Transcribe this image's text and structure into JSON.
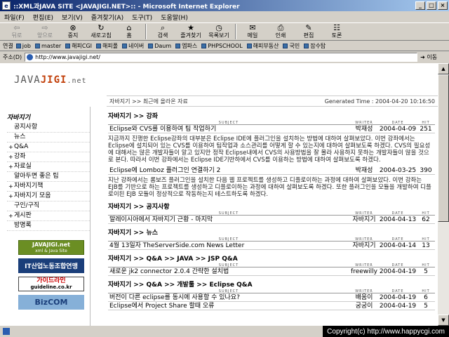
{
  "window": {
    "title": "::XML과JAVA SITE <JAVAJIGI.NET>:: - Microsoft Internet Explorer"
  },
  "menu": [
    "파일(F)",
    "편집(E)",
    "보기(V)",
    "즐겨찾기(A)",
    "도구(T)",
    "도움말(H)"
  ],
  "toolbar": [
    {
      "label": "뒤로",
      "icon": "back-arrow-icon",
      "disabled": true
    },
    {
      "label": "앞으로",
      "icon": "forward-arrow-icon",
      "disabled": true
    },
    {
      "label": "중지",
      "icon": "stop-icon"
    },
    {
      "label": "새로고침",
      "icon": "refresh-icon"
    },
    {
      "label": "홈",
      "icon": "home-icon"
    },
    {
      "label": "검색",
      "icon": "search-icon"
    },
    {
      "label": "즐겨찾기",
      "icon": "favorites-icon"
    },
    {
      "label": "목록보기",
      "icon": "history-icon"
    },
    {
      "label": "메일",
      "icon": "mail-icon"
    },
    {
      "label": "인쇄",
      "icon": "print-icon"
    },
    {
      "label": "편집",
      "icon": "edit-icon"
    },
    {
      "label": "토론",
      "icon": "discuss-icon"
    }
  ],
  "links": {
    "label": "연결",
    "items": [
      "job",
      "master",
      "해피CGI",
      "해피폴",
      "네이버",
      "Daum",
      "엠파스",
      "PHPSCHOOL",
      "해피부동산",
      "국민",
      "잡수탑"
    ]
  },
  "address": {
    "label": "주소(D)",
    "value": "http://www.javajigi.net/",
    "go": "이동"
  },
  "page": {
    "logo": {
      "prefix": "JAVA",
      "brand": "JIGI",
      "suffix": ".net"
    },
    "breadcrumb": "자바지기 >> 최근에 올라온 자료",
    "generated": "Generated Time : 2004-04-20 10:16:50",
    "sidebar": {
      "heading": "자바지기",
      "items": [
        {
          "label": "공지사항",
          "plus": false
        },
        {
          "label": "뉴스",
          "plus": false
        },
        {
          "label": "Q&A",
          "plus": true
        },
        {
          "label": "강좌",
          "plus": true
        },
        {
          "label": "자료실",
          "plus": true
        },
        {
          "label": "알아두면 좋은 팁",
          "plus": false
        },
        {
          "label": "자바지기책",
          "plus": true
        },
        {
          "label": "자바지기 모음",
          "plus": true
        },
        {
          "label": "구인/구직",
          "plus": false
        },
        {
          "label": "게시판",
          "plus": true
        },
        {
          "label": "방명록",
          "plus": false
        }
      ]
    },
    "banners": {
      "javajigi": {
        "line1": "JAVAJIGI.net",
        "line2": "xml & Java Site"
      },
      "it_union": "IT산업노동조합연맹",
      "guideline": {
        "line1": "가이드라인",
        "line2": "guideline.co.kr"
      },
      "bizcom": "BizCOM"
    },
    "column_headers": {
      "subject": "SUBJECT",
      "writer": "WRITER",
      "date": "DATE",
      "hit": "HIT"
    },
    "sections": [
      {
        "title": "자바지기 >> 강좌",
        "rows": [
          {
            "subject": "Eclipse와 CVS를 이용하여 팀 작업하기",
            "writer": "박재성",
            "date": "2004-04-09",
            "hit": "251",
            "summary": "지금까지 진행한 Eclipse강좌의 대부분은 Eclipse IDE에 플러그인을 설치하는 방법에 대하여 살펴보았다. 이번 강좌에서는 Eclipse에 설치되어 있는 CVS를 이용하여 팀작업과 소스관리를 어떻게 할 수 있는지에 대하여 살펴보도록 하겠다. CVS의 필요성에 대해서는 많은 개발자들이 알고 있지만 정작 Eclipse내에서 CVS의 사용방법을 잘 몰라 사용하지 못하는 개발자들이 많을 것으로 본다. 따라서 이번 강좌에서는 Eclipse IDE기반하에서 CVS를 이용하는 방법에 대하여 살펴보도록 하겠다."
          },
          {
            "subject": "Eclipse에 Lomboz 플러그인 연결하기 2",
            "writer": "박재성",
            "date": "2004-03-25",
            "hit": "390",
            "summary": "지난 강좌에서는 롬보즈 플러그인을 설치한 다음 웹 프로젝트를 생성하고 디플로이하는 과정에 대하여 살펴보았다. 이번 강좌는 EJB를 기반으로 하는 프로젝트를 생성하고 디플로이하는 과정에 대하여 살펴보도록 하겠다. 또한 플러그인을 모듈을 개발하여 디플로이된 EJB 모듈이 정상적으로 작동하는지 테스트하도록 하겠다."
          }
        ]
      },
      {
        "title": "자바지기 >> 공지사항",
        "rows": [
          {
            "subject": "말레이시아에서 자바지기 근황 - 마지막",
            "writer": "자바지기",
            "date": "2004-04-13",
            "hit": "62"
          }
        ]
      },
      {
        "title": "자바지기 >> 뉴스",
        "rows": [
          {
            "subject": "4월 13일자 TheServerSide.com News Letter",
            "writer": "자바지기",
            "date": "2004-04-14",
            "hit": "13"
          }
        ]
      },
      {
        "title": "자바지기 >> Q&A >> JAVA >> JSP Q&A",
        "rows": [
          {
            "subject": "새로운 jk2 connector 2.0.4 간략한 설치법",
            "writer": "freewilly",
            "date": "2004-04-19",
            "hit": "5"
          }
        ]
      },
      {
        "title": "자바지기 >> Q&A >> 개발툴 >> Eclipse Q&A",
        "rows": [
          {
            "subject": "버전이 다른 eclipse를 동시에 사용할 수 있나요?",
            "writer": "배움이",
            "date": "2004-04-19",
            "hit": "6"
          },
          {
            "subject": "Eclipse에서 Project Share 할때 오류",
            "writer": "궁궁이",
            "date": "2004-04-19",
            "hit": "5"
          }
        ]
      }
    ]
  },
  "status": {
    "text": "",
    "copyright": "Copyright(c) http://www.happycgi.com"
  }
}
